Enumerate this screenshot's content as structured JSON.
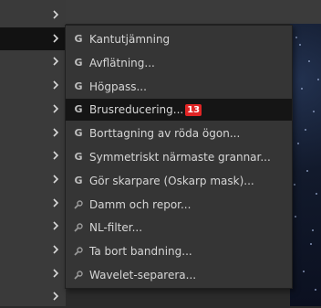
{
  "colors": {
    "menu_bg": "#353535",
    "highlight_bg": "#151515",
    "text": "#d6d6d6",
    "badge_bg": "#e02525"
  },
  "parent_menu": {
    "active_index": 1,
    "row_count": 13,
    "chevron_icon": "chevron-right-icon"
  },
  "submenu": {
    "items": [
      {
        "label": "Kantutjämning",
        "icon": "gegl-icon",
        "icon_text": "G"
      },
      {
        "label": "Avflätning...",
        "icon": "gegl-icon",
        "icon_text": "G"
      },
      {
        "label": "Högpass...",
        "icon": "gegl-icon",
        "icon_text": "G"
      },
      {
        "label": "Brusreducering...",
        "icon": "gegl-icon",
        "icon_text": "G",
        "highlighted": true,
        "badge": "13"
      },
      {
        "label": "Borttagning av röda ögon...",
        "icon": "gegl-icon",
        "icon_text": "G"
      },
      {
        "label": "Symmetriskt närmaste grannar...",
        "icon": "gegl-icon",
        "icon_text": "G"
      },
      {
        "label": "Gör skarpare (Oskarp mask)...",
        "icon": "gegl-icon",
        "icon_text": "G"
      },
      {
        "label": "Damm och repor...",
        "icon": "plugin-icon"
      },
      {
        "label": "NL-filter...",
        "icon": "plugin-icon"
      },
      {
        "label": "Ta bort bandning...",
        "icon": "plugin-icon"
      },
      {
        "label": "Wavelet-separera...",
        "icon": "plugin-icon"
      }
    ]
  }
}
